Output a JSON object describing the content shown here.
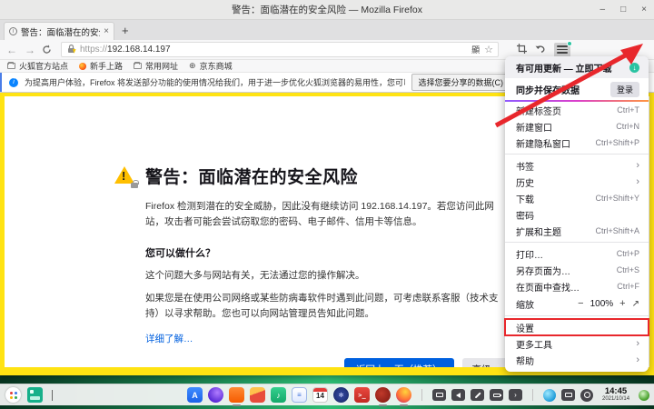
{
  "colors": {
    "accent_blue": "#0060df",
    "frame_yellow": "#ffe312",
    "annotation_red": "#e8272c",
    "update_green": "#2ac3a2"
  },
  "titlebar": {
    "title": "警告：面临潜在的安全风险 — Mozilla Firefox",
    "minimize": "–",
    "maximize": "□",
    "close": "×"
  },
  "tabbar": {
    "favicon_glyph": "i",
    "tab_title": "警告：面临潜在的安全风险",
    "tab_close": "×",
    "new_tab": "+"
  },
  "navbar": {
    "back": "←",
    "forward": "→",
    "url_scheme": "https://",
    "url_host": "192.168.14.197",
    "translate_glyph": "顯",
    "star": "☆"
  },
  "bookmarks": {
    "items": [
      {
        "label": "火狐官方站点"
      },
      {
        "label": "新手上路"
      },
      {
        "label": "常用网址"
      },
      {
        "label": "京东商城"
      }
    ],
    "jd_glyph": "⊕"
  },
  "notification": {
    "info_glyph": "i",
    "text": "为提高用户体验，Firefox 将发送部分功能的使用情况给我们，用于进一步优化火狐浏览器的易用性，您可以自由选择是否向我们分享数据。",
    "button_label": "选择您要分享的数据(C)"
  },
  "page": {
    "title": "警告：面临潜在的安全风险",
    "para1": "Firefox 检测到潜在的安全威胁，因此没有继续访问 192.168.14.197。若您访问此网站，攻击者可能会尝试窃取您的密码、电子邮件、信用卡等信息。",
    "subheading": "您可以做什么？",
    "para2": "这个问题大多与网站有关，无法通过您的操作解决。",
    "para3": "如果您是在使用公司网络或某些防病毒软件时遇到此问题，可考虑联系客服（技术支持）以寻求帮助。您也可以向网站管理员告知此问题。",
    "learn_more": "详细了解…",
    "back_button": "返回上一页（推荐）",
    "advanced_button": "高级…"
  },
  "menu": {
    "update_label": "有可用更新 — 立即下载",
    "update_glyph": "↓",
    "sync_label": "同步并保存数据",
    "signin_button": "登录",
    "submenu_glyph": "›",
    "items": [
      {
        "label": "新建标签页",
        "accel": "Ctrl+T"
      },
      {
        "label": "新建窗口",
        "accel": "Ctrl+N"
      },
      {
        "label": "新建隐私窗口",
        "accel": "Ctrl+Shift+P"
      },
      {
        "label": "书签",
        "accel": ""
      },
      {
        "label": "历史",
        "accel": ""
      },
      {
        "label": "下载",
        "accel": "Ctrl+Shift+Y"
      },
      {
        "label": "密码",
        "accel": ""
      },
      {
        "label": "扩展和主题",
        "accel": "Ctrl+Shift+A"
      },
      {
        "label": "打印…",
        "accel": "Ctrl+P"
      },
      {
        "label": "另存页面为…",
        "accel": "Ctrl+S"
      },
      {
        "label": "在页面中查找…",
        "accel": "Ctrl+F"
      },
      {
        "label": "设置",
        "accel": ""
      },
      {
        "label": "更多工具",
        "accel": ""
      },
      {
        "label": "帮助",
        "accel": ""
      }
    ],
    "zoom": {
      "label": "缩放",
      "out": "−",
      "value": "100%",
      "in": "+",
      "fullscreen": "↗"
    }
  },
  "taskbar": {
    "calendar_day": "14",
    "terminal_glyph": ">_",
    "expand_glyph": "›",
    "time": "14:45",
    "date": "2021/10/14"
  }
}
